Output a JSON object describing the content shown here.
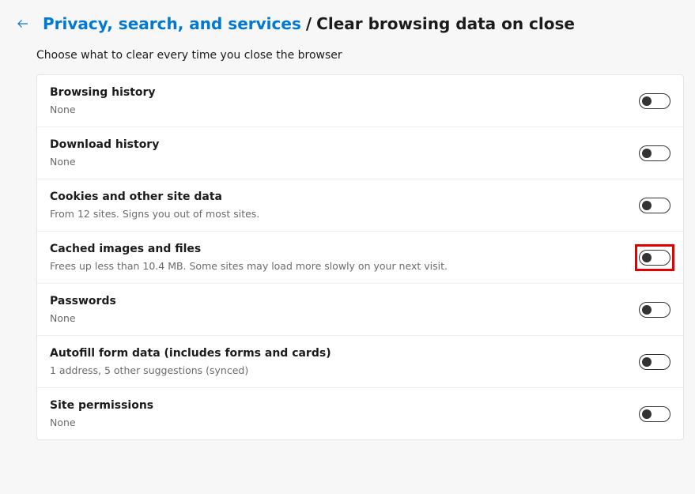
{
  "header": {
    "breadcrumb_link": "Privacy, search, and services",
    "breadcrumb_sep": "/",
    "breadcrumb_current": "Clear browsing data on close"
  },
  "subtitle": "Choose what to clear every time you close the browser",
  "rows": [
    {
      "title": "Browsing history",
      "desc": "None"
    },
    {
      "title": "Download history",
      "desc": "None"
    },
    {
      "title": "Cookies and other site data",
      "desc": "From 12 sites. Signs you out of most sites."
    },
    {
      "title": "Cached images and files",
      "desc": "Frees up less than 10.4 MB. Some sites may load more slowly on your next visit."
    },
    {
      "title": "Passwords",
      "desc": "None"
    },
    {
      "title": "Autofill form data (includes forms and cards)",
      "desc": "1 address, 5 other suggestions (synced)"
    },
    {
      "title": "Site permissions",
      "desc": "None"
    }
  ]
}
